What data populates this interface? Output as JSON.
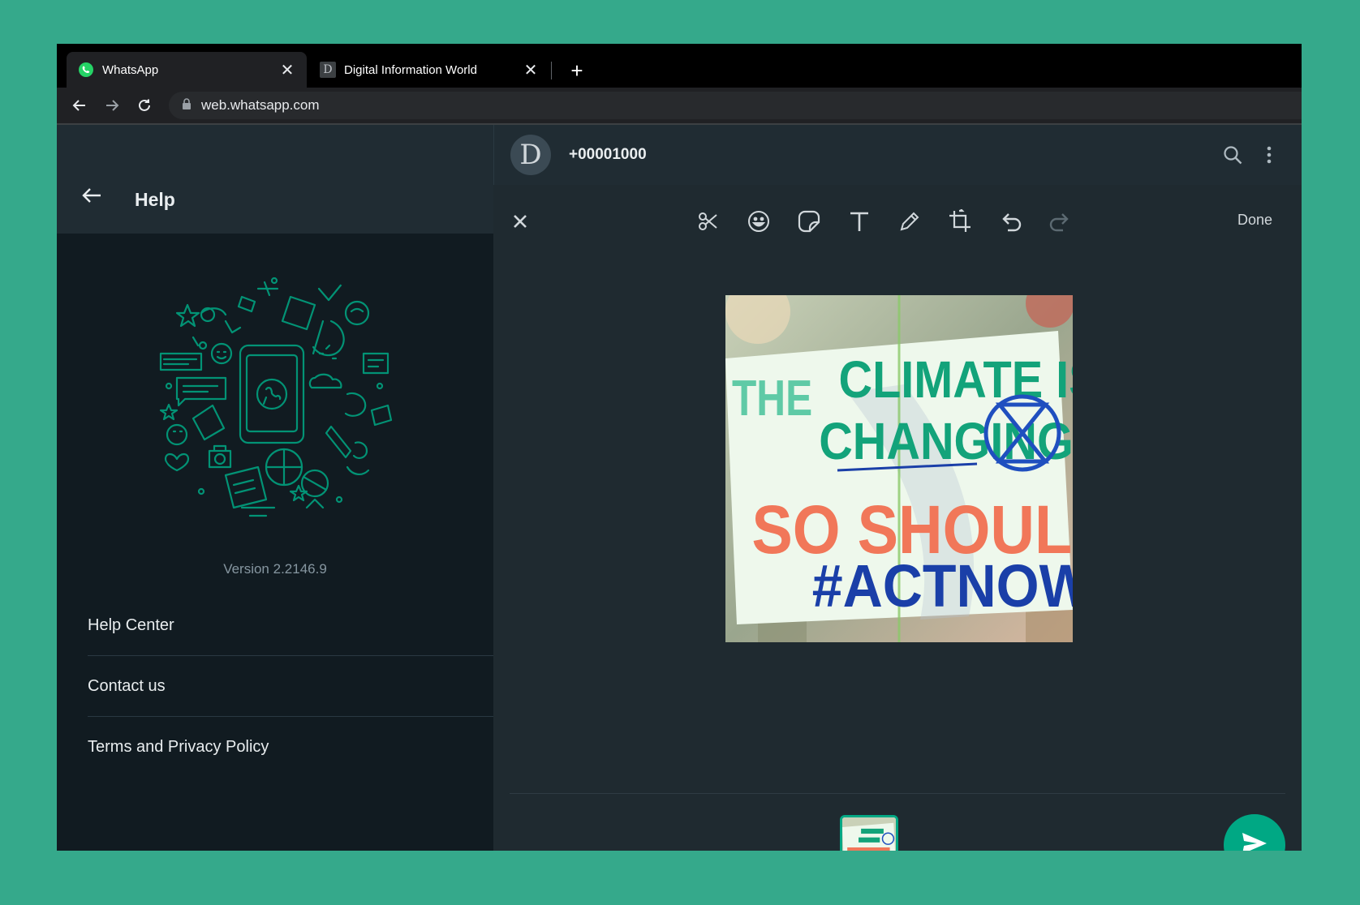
{
  "browser": {
    "tabs": [
      {
        "title": "WhatsApp",
        "icon": "whatsapp-icon",
        "active": true
      },
      {
        "title": "Digital Information World",
        "icon": "d-favicon",
        "favicon_letter": "D",
        "active": false
      }
    ],
    "url": "web.whatsapp.com"
  },
  "help_panel": {
    "title": "Help",
    "version": "Version 2.2146.9",
    "items": [
      {
        "label": "Help Center"
      },
      {
        "label": "Contact us"
      },
      {
        "label": "Terms and Privacy Policy"
      }
    ]
  },
  "chat": {
    "avatar_letter": "D",
    "contact": "+00001000"
  },
  "editor": {
    "done_label": "Done",
    "image_text": {
      "line1a": "THE",
      "line1b": "CLIMATE IS",
      "line2": "CHANGING",
      "line3": "SO SHOULD WE!",
      "line4": "#ACTNOW"
    }
  },
  "colors": {
    "accent": "#00a884",
    "background": "#35a98b",
    "panel_dark": "#111b21",
    "header": "#202c33"
  }
}
